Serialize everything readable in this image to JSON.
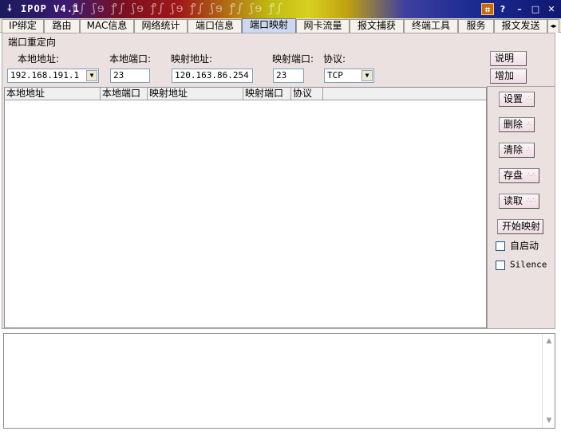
{
  "window": {
    "title": "IPOP V4.1",
    "app_icon": "app-icon",
    "controls": [
      "system-menu-icon",
      "help-icon",
      "minimize-icon",
      "maximize-icon",
      "close-icon"
    ],
    "control_glyphs": {
      "help": "?",
      "minimize": "–",
      "maximize": "□",
      "close": "✕"
    }
  },
  "tabs": [
    {
      "label": "IP绑定"
    },
    {
      "label": "路由"
    },
    {
      "label": "MAC信息"
    },
    {
      "label": "网络统计"
    },
    {
      "label": "端口信息"
    },
    {
      "label": "端口映射",
      "active": true
    },
    {
      "label": "网卡流量"
    },
    {
      "label": "报文捕获"
    },
    {
      "label": "终端工具"
    },
    {
      "label": "服务"
    },
    {
      "label": "报文发送"
    }
  ],
  "port_mapping": {
    "group_title": "端口重定向",
    "fields": {
      "local_address_label": "本地地址:",
      "local_address_value": "192.168.191.1",
      "local_port_label": "本地端口:",
      "local_port_value": "23",
      "mapped_address_label": "映射地址:",
      "mapped_address_value": "120.163.86.254",
      "mapped_port_label": "映射端口:",
      "mapped_port_value": "23",
      "protocol_label": "协议:",
      "protocol_value": "TCP"
    },
    "table": {
      "columns": [
        "本地地址",
        "本地端口",
        "映射地址",
        "映射端口",
        "协议"
      ],
      "rows": []
    },
    "buttons": {
      "help": "说明",
      "add": "增加",
      "settings": "设置",
      "delete": "删除",
      "clear": "清除",
      "save": "存盘",
      "load": "读取",
      "start_mapping": "开始映射"
    },
    "checkboxes": {
      "autostart": {
        "label": "自启动",
        "checked": false
      },
      "silence": {
        "label": "Silence",
        "checked": false
      }
    }
  },
  "colors": {
    "panel_bg": "#ece1e1",
    "active_tab": "#cdd8ee",
    "input_border": "#7f9db9"
  }
}
